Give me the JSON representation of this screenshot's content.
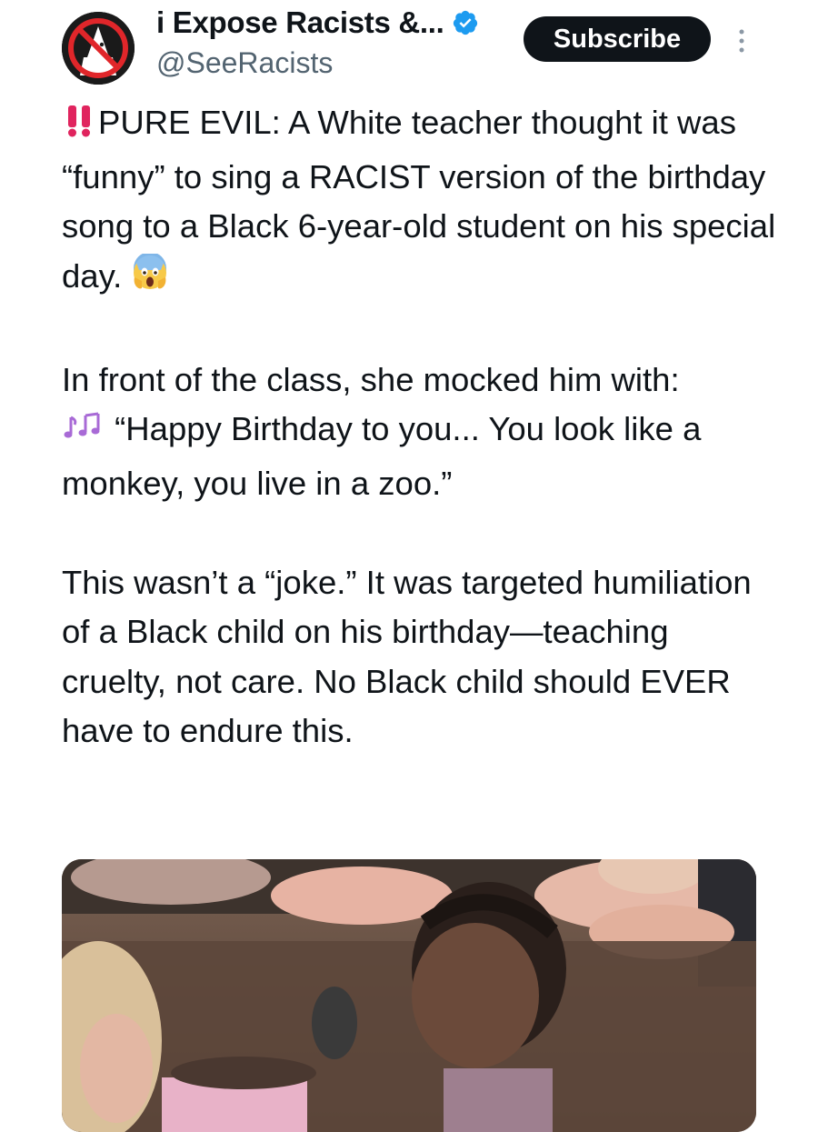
{
  "account": {
    "display_name": "i Expose Racists &...",
    "handle": "@SeeRacists",
    "avatar_icon": "no-racism-avatar-icon",
    "verified_icon": "verified-badge-icon",
    "verified_color": "#1d9bf0"
  },
  "actions": {
    "subscribe_label": "Subscribe",
    "more_icon": "more-vertical-icon"
  },
  "post": {
    "line1_text": "PURE EVIL: A White teacher thought it was “funny” to sing a RACIST version of the birthday song to a Black 6-year-old student on his special day.",
    "line1_emoji_lead": "‼️",
    "line1_emoji_trail": "😱",
    "para2_text": "In front of the class, she mocked him with:",
    "quote_emoji": "🎶",
    "quote_text": "“Happy Birthday to you... You look like a monkey, you live in a zoo.”",
    "para3_text": "This wasn’t a “joke.” It was targeted humiliation of a Black child on his birthday—teaching cruelty, not care. No Black child should EVER have to endure this."
  },
  "media": {
    "description_icon": "classroom-video-thumbnail"
  },
  "colors": {
    "text": "#0f1419",
    "secondary": "#536471",
    "button_bg": "#0f1419",
    "button_text": "#ffffff",
    "exclaim": "#e0245e"
  }
}
